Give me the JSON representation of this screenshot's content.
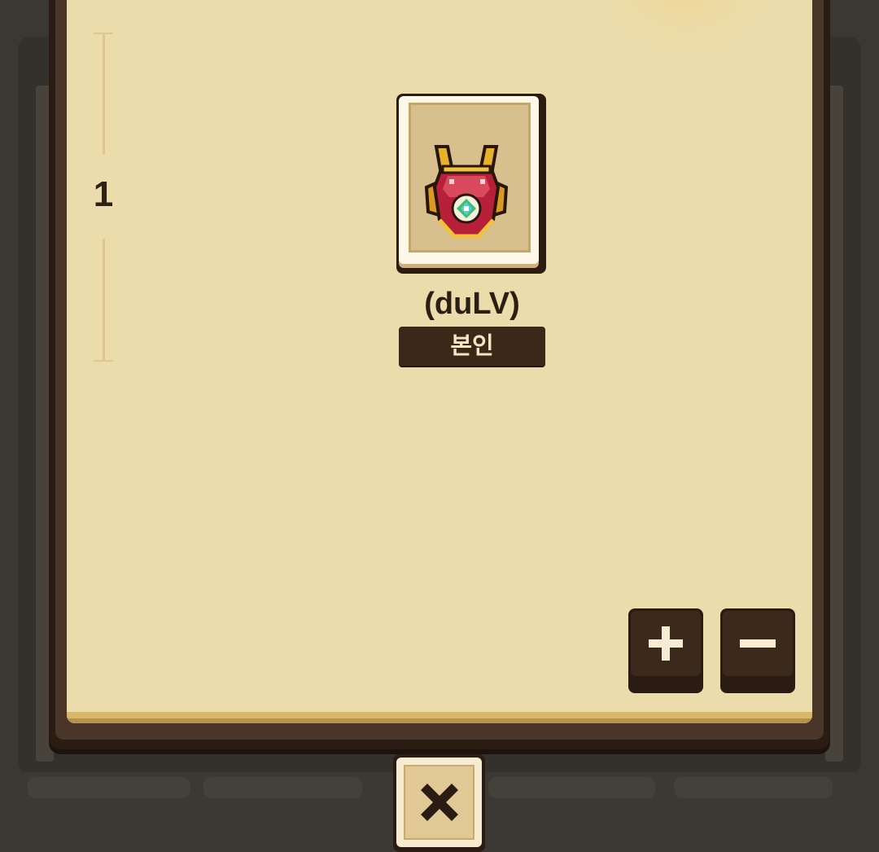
{
  "ranking": {
    "rank": "1",
    "player_name": "(duLV)",
    "self_label": "본인",
    "item_icon": "crimson-gold-armor-icon"
  },
  "controls": {
    "zoom_in_icon": "plus-icon",
    "zoom_out_icon": "minus-icon",
    "close_icon": "close-icon"
  },
  "colors": {
    "paper": "#ebdcab",
    "frame_dark": "#2a1c12",
    "badge_bg": "#3a2818",
    "badge_text": "#f4e6c2"
  }
}
